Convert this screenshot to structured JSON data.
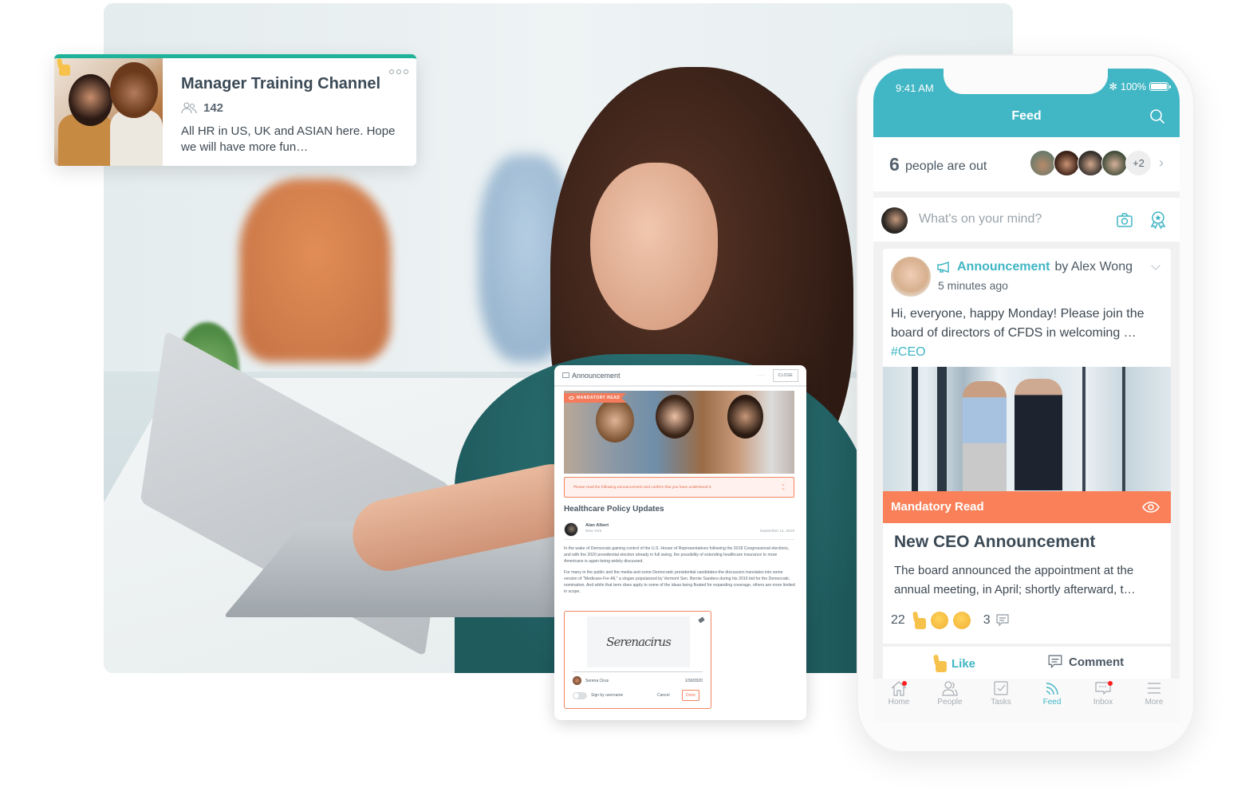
{
  "channel_card": {
    "title": "Manager Training Channel",
    "member_count": "142",
    "description": "All HR in US, UK and ASIAN here. Hope we will have more fun…",
    "accent_color": "#1fb29a"
  },
  "announcement_panel": {
    "header_label": "Announcement",
    "close_label": "CLOSE",
    "more_label": "···",
    "badge_label": "MANDATORY READ",
    "notice_text": "Please read the following announcement and confirm that you have understood it.",
    "title": "Healthcare Policy Updates",
    "author_name": "Alan Albert",
    "author_location": "New York",
    "date": "September 12, 2019",
    "paragraphs": [
      "In the wake of Democrats gaining control of the U.S. House of Representatives following the 2018 Congressional elections, and with the 2020 presidential election already in full swing, the possibility of extending healthcare insurance to more Americans is again being widely discussed.",
      "For many in the public and the media-and some Democratic presidential candidates-the discussion translates into some version of \"Medicare-For-All,\" a slogan popularized by Vermont Sen. Bernie Sanders during his 2016 bid for the Democratic nomination. And while that term does apply to some of the ideas being floated for expanding coverage, others are more limited in scope."
    ],
    "signature": {
      "signature_text": "Serenacirus",
      "signer_name": "Serena Cirus",
      "signed_date": "1/30/2020",
      "toggle_label": "Sign by username",
      "toggle_on": false,
      "cancel_label": "Cancel",
      "done_label": "Done"
    },
    "accent_color": "#f4845f"
  },
  "phone": {
    "status_bar": {
      "time": "9:41 AM",
      "bluetooth": "✻",
      "battery": "100%"
    },
    "nav_title": "Feed",
    "out_summary": {
      "count": "6",
      "label": "people are out",
      "extra_count": "+2"
    },
    "composer": {
      "placeholder": "What's on your mind?"
    },
    "post": {
      "kind": "Announcement",
      "by_label": "by Alex Wong",
      "time_ago": "5 minutes ago",
      "text": "Hi, everyone, happy Monday! Please join the board of directors of CFDS in welcoming …",
      "hashtag": "#CEO",
      "mandatory_label": "Mandatory Read",
      "headline": "New CEO Announcement",
      "summary": "The board announced the appointment at the annual meeting, in April; shortly afterward, t…",
      "reaction_count": "22",
      "comment_count": "3"
    },
    "actions": {
      "like_label": "Like",
      "comment_label": "Comment"
    },
    "tabs": [
      {
        "label": "Home",
        "icon": "home-icon",
        "badge": true,
        "active": false
      },
      {
        "label": "People",
        "icon": "people-icon",
        "badge": false,
        "active": false
      },
      {
        "label": "Tasks",
        "icon": "tasks-icon",
        "badge": false,
        "active": false
      },
      {
        "label": "Feed",
        "icon": "feed-icon",
        "badge": false,
        "active": true
      },
      {
        "label": "Inbox",
        "icon": "inbox-icon",
        "badge": true,
        "active": false
      },
      {
        "label": "More",
        "icon": "menu-icon",
        "badge": false,
        "active": false
      }
    ],
    "primary_color": "#41b6c4",
    "mandatory_color": "#f98058"
  }
}
